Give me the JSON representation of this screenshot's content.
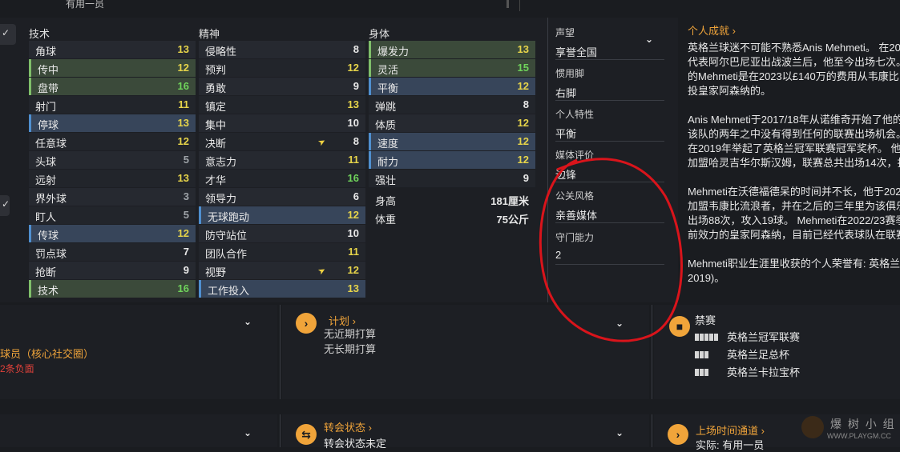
{
  "topbar": {
    "text": "有用一员"
  },
  "columns": {
    "technical": {
      "title": "技术",
      "rows": [
        {
          "name": "角球",
          "value": "13",
          "style": "plain",
          "color": "yellow"
        },
        {
          "name": "传中",
          "value": "12",
          "style": "green",
          "color": "yellow"
        },
        {
          "name": "盘带",
          "value": "16",
          "style": "green",
          "color": "green"
        },
        {
          "name": "射门",
          "value": "11",
          "style": "plain",
          "color": "yellow"
        },
        {
          "name": "停球",
          "value": "13",
          "style": "blue",
          "color": "yellow"
        },
        {
          "name": "任意球",
          "value": "12",
          "style": "plain",
          "color": "yellow"
        },
        {
          "name": "头球",
          "value": "5",
          "style": "plain",
          "color": "grey"
        },
        {
          "name": "远射",
          "value": "13",
          "style": "plain",
          "color": "yellow"
        },
        {
          "name": "界外球",
          "value": "3",
          "style": "plain",
          "color": "grey"
        },
        {
          "name": "盯人",
          "value": "5",
          "style": "plain",
          "color": "grey"
        },
        {
          "name": "传球",
          "value": "12",
          "style": "blue",
          "color": "yellow"
        },
        {
          "name": "罚点球",
          "value": "7",
          "style": "plain",
          "color": "white"
        },
        {
          "name": "抢断",
          "value": "9",
          "style": "plain",
          "color": "white"
        },
        {
          "name": "技术",
          "value": "16",
          "style": "green",
          "color": "green"
        }
      ]
    },
    "mental": {
      "title": "精神",
      "rows": [
        {
          "name": "侵略性",
          "value": "8",
          "style": "plain",
          "color": "white"
        },
        {
          "name": "预判",
          "value": "12",
          "style": "plain",
          "color": "yellow"
        },
        {
          "name": "勇敢",
          "value": "9",
          "style": "plain",
          "color": "white"
        },
        {
          "name": "镇定",
          "value": "13",
          "style": "plain",
          "color": "yellow"
        },
        {
          "name": "集中",
          "value": "10",
          "style": "plain",
          "color": "white"
        },
        {
          "name": "决断",
          "value": "8",
          "style": "plain",
          "color": "white",
          "arrow": true
        },
        {
          "name": "意志力",
          "value": "11",
          "style": "plain",
          "color": "yellow"
        },
        {
          "name": "才华",
          "value": "16",
          "style": "plain",
          "color": "green"
        },
        {
          "name": "领导力",
          "value": "6",
          "style": "plain",
          "color": "white"
        },
        {
          "name": "无球跑动",
          "value": "12",
          "style": "blue",
          "color": "yellow"
        },
        {
          "name": "防守站位",
          "value": "10",
          "style": "plain",
          "color": "white"
        },
        {
          "name": "团队合作",
          "value": "11",
          "style": "plain",
          "color": "yellow"
        },
        {
          "name": "视野",
          "value": "12",
          "style": "plain",
          "color": "yellow",
          "arrow": true
        },
        {
          "name": "工作投入",
          "value": "13",
          "style": "blue",
          "color": "yellow"
        }
      ]
    },
    "physical": {
      "title": "身体",
      "rows": [
        {
          "name": "爆发力",
          "value": "13",
          "style": "green",
          "color": "yellow"
        },
        {
          "name": "灵活",
          "value": "15",
          "style": "green",
          "color": "green"
        },
        {
          "name": "平衡",
          "value": "12",
          "style": "blue",
          "color": "yellow"
        },
        {
          "name": "弹跳",
          "value": "8",
          "style": "plain",
          "color": "white"
        },
        {
          "name": "体质",
          "value": "12",
          "style": "plain",
          "color": "yellow"
        },
        {
          "name": "速度",
          "value": "12",
          "style": "blue",
          "color": "yellow"
        },
        {
          "name": "耐力",
          "value": "12",
          "style": "blue",
          "color": "yellow"
        },
        {
          "name": "强壮",
          "value": "9",
          "style": "plain",
          "color": "white"
        }
      ],
      "height_label": "身高",
      "height_value": "181厘米",
      "weight_label": "体重",
      "weight_value": "75公斤"
    }
  },
  "info": {
    "reputation_label": "声望",
    "reputation_value": "享誉全国",
    "foot_label": "惯用脚",
    "foot_value": "右脚",
    "trait_label": "个人特性",
    "trait_value": "平衡",
    "media_label": "媒体评价",
    "media_value": "边锋",
    "pr_label": "公关风格",
    "pr_value": "亲善媒体",
    "gk_label": "守门能力",
    "gk_value": "2"
  },
  "bio": {
    "title": "个人成就 ›",
    "lines": [
      "英格兰球迷不可能不熟悉Anis Mehmeti。 在20",
      "代表阿尔巴尼亚出战波兰后，他至今出场七次。",
      "的Mehmeti是在2023以£140万的费用从韦康比",
      "投皇家阿森纳的。",
      "",
      "Anis Mehmeti于2017/18年从诺维奇开始了他的",
      "该队的两年之中没有得到任何的联赛出场机会。",
      "在2019年举起了英格兰冠军联赛冠军奖杯。 他",
      "加盟哈灵吉华尔斯汉姆，联赛总共出场14次，打",
      "",
      "Mehmeti在沃德福德呆的时间并不长，他于202",
      "加盟韦康比流浪者，并在之后的三年里为该俱乐",
      "出场88次，攻入19球。 Mehmeti在2022/23赛季",
      "前效力的皇家阿森纳，目前已经代表球队在联赛",
      "",
      "Mehmeti职业生涯里收获的个人荣誉有: 英格兰",
      "2019)。"
    ]
  },
  "bottom": {
    "player_label": "球员（核心社交圈）",
    "negative_text": "2条负面",
    "plan_title": "计划 ›",
    "plan_line1": "无近期打算",
    "plan_line2": "无长期打算",
    "ban_title": "禁赛",
    "bans": [
      {
        "name": "英格兰冠军联赛",
        "bars": 5
      },
      {
        "name": "英格兰足总杯",
        "bars": 3
      },
      {
        "name": "英格兰卡拉宝杯",
        "bars": 3
      }
    ],
    "transfer_title": "转会状态 ›",
    "transfer_value": "转会状态未定",
    "playtime_title": "上场时间通道 ›",
    "playtime_value": "实际: 有用一员"
  },
  "watermark": {
    "text": "爆 树 小 组",
    "url": "WWW.PLAYGM.CC"
  },
  "colors": {
    "yellow": "#e6d44a",
    "green": "#6fd35b",
    "orange": "#f0a43a",
    "annotation": "#d9141b"
  }
}
